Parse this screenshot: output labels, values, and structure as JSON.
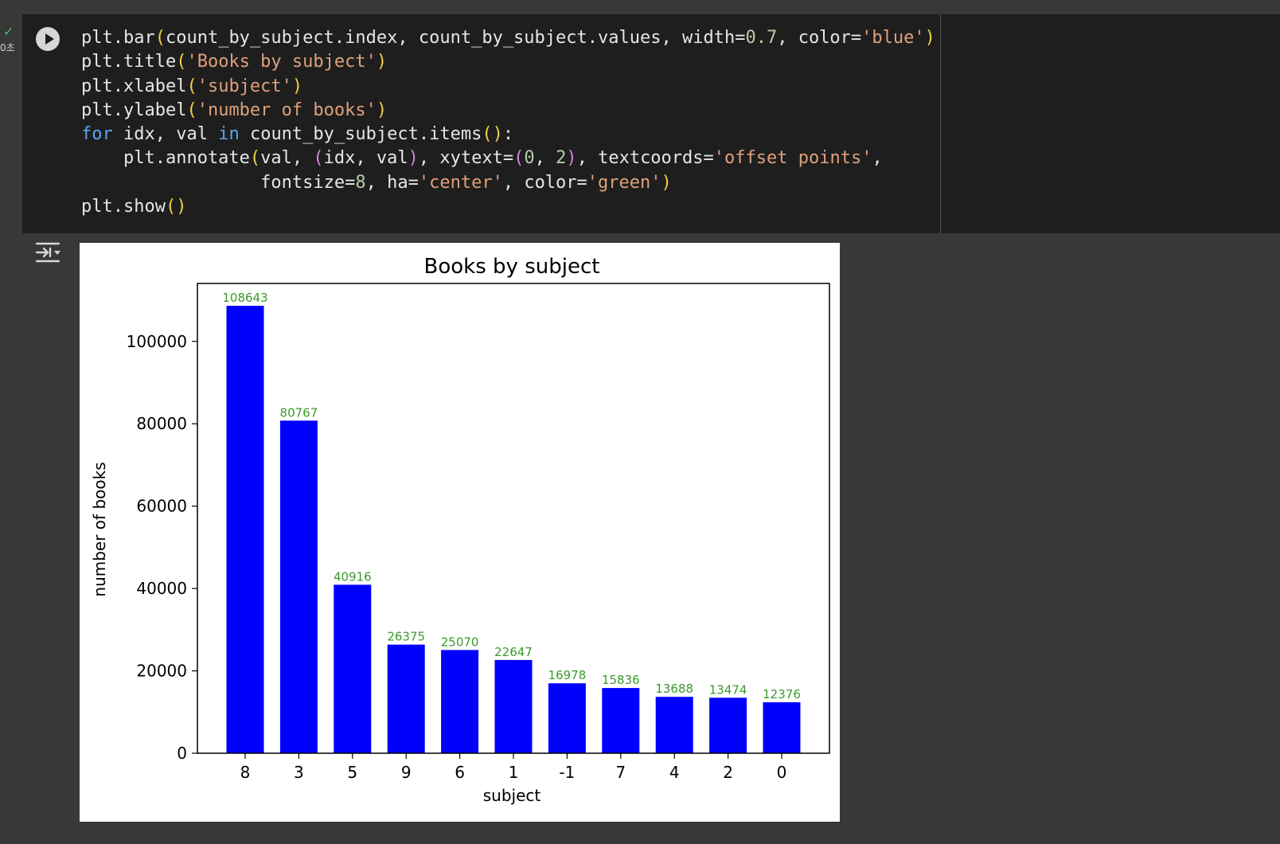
{
  "cell": {
    "status": {
      "icon": "check-icon",
      "exec_time": "0초"
    },
    "run_icon": "play-icon",
    "code_lines": [
      [
        [
          "plt.bar",
          "f"
        ],
        [
          "(",
          "p"
        ],
        [
          "count_by_subject.index, count_by_subject.values, width=",
          "f"
        ],
        [
          "0.7",
          "n"
        ],
        [
          ", color=",
          "f"
        ],
        [
          "'blue'",
          "s"
        ],
        [
          ")",
          "p"
        ]
      ],
      [
        [
          "plt.title",
          "f"
        ],
        [
          "(",
          "p"
        ],
        [
          "'Books by subject'",
          "s"
        ],
        [
          ")",
          "p"
        ]
      ],
      [
        [
          "plt.xlabel",
          "f"
        ],
        [
          "(",
          "p"
        ],
        [
          "'subject'",
          "s"
        ],
        [
          ")",
          "p"
        ]
      ],
      [
        [
          "plt.ylabel",
          "f"
        ],
        [
          "(",
          "p"
        ],
        [
          "'number of books'",
          "s"
        ],
        [
          ")",
          "p"
        ]
      ],
      [
        [
          "for",
          "k"
        ],
        [
          " idx, val ",
          "f"
        ],
        [
          "in",
          "k"
        ],
        [
          " count_by_subject.items",
          "f"
        ],
        [
          "()",
          "p"
        ],
        [
          ":",
          "f"
        ]
      ],
      [
        [
          "    plt.annotate",
          "f"
        ],
        [
          "(",
          "p"
        ],
        [
          "val, ",
          "f"
        ],
        [
          "(",
          "p2"
        ],
        [
          "idx, val",
          "f"
        ],
        [
          ")",
          "p2"
        ],
        [
          ", xytext=",
          "f"
        ],
        [
          "(",
          "p2"
        ],
        [
          "0",
          "n"
        ],
        [
          ", ",
          "f"
        ],
        [
          "2",
          "n"
        ],
        [
          ")",
          "p2"
        ],
        [
          ", textcoords=",
          "f"
        ],
        [
          "'offset points'",
          "s"
        ],
        [
          ",",
          "f"
        ]
      ],
      [
        [
          "                 fontsize=",
          "f"
        ],
        [
          "8",
          "n"
        ],
        [
          ", ha=",
          "f"
        ],
        [
          "'center'",
          "s"
        ],
        [
          ", color=",
          "f"
        ],
        [
          "'green'",
          "s"
        ],
        [
          ")",
          "p"
        ]
      ],
      [
        [
          "plt.show",
          "f"
        ],
        [
          "()",
          "p"
        ]
      ]
    ]
  },
  "output": {
    "toggle_icon": "output-collapse-icon"
  },
  "colors": {
    "bar": "#0000ff",
    "annotation": "#3a9a2a"
  },
  "chart_data": {
    "type": "bar",
    "title": "Books by subject",
    "xlabel": "subject",
    "ylabel": "number of books",
    "categories": [
      "8",
      "3",
      "5",
      "9",
      "6",
      "1",
      "-1",
      "7",
      "4",
      "2",
      "0"
    ],
    "values": [
      108643,
      80767,
      40916,
      26375,
      25070,
      22647,
      16978,
      15836,
      13688,
      13474,
      12376
    ],
    "data_labels": [
      "108643",
      "80767",
      "40916",
      "26375",
      "25070",
      "22647",
      "16978",
      "15836",
      "13688",
      "13474",
      "12376"
    ],
    "yticks": [
      "0",
      "20000",
      "40000",
      "60000",
      "80000",
      "100000"
    ],
    "ylim": [
      0,
      114075
    ],
    "grid": false,
    "bar_color": "blue",
    "label_color": "green"
  }
}
